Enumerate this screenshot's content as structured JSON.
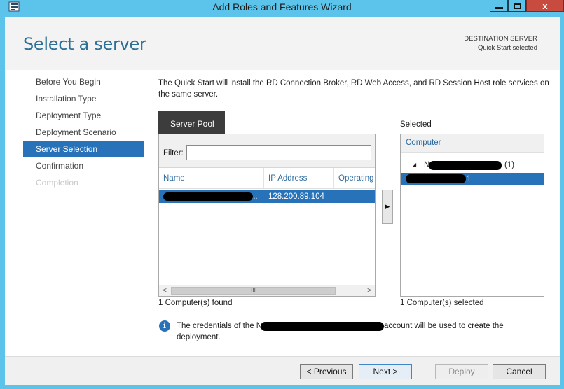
{
  "window": {
    "title": "Add Roles and Features Wizard",
    "minimize_icon": "minimize-icon",
    "maximize_icon": "maximize-icon",
    "close_label": "x"
  },
  "header": {
    "page_title": "Select a server",
    "destination_label": "DESTINATION SERVER",
    "destination_value": "Quick Start selected"
  },
  "nav": {
    "items": [
      {
        "label": "Before You Begin",
        "state": "normal"
      },
      {
        "label": "Installation Type",
        "state": "normal"
      },
      {
        "label": "Deployment Type",
        "state": "normal"
      },
      {
        "label": "Deployment Scenario",
        "state": "normal"
      },
      {
        "label": "Server Selection",
        "state": "active"
      },
      {
        "label": "Confirmation",
        "state": "normal"
      },
      {
        "label": "Completion",
        "state": "disabled"
      }
    ]
  },
  "content": {
    "description": "The Quick Start will install the RD Connection Broker, RD Web Access, and RD Session Host role services on the same server.",
    "pool_tab_label": "Server Pool",
    "filter_label": "Filter:",
    "filter_value": "",
    "columns": [
      "Name",
      "IP Address",
      "Operating"
    ],
    "rows": [
      {
        "name_suffix": "...",
        "ip": "128.200.89.104"
      }
    ],
    "scroll_thumb_glyph": "III",
    "scroll_left": "<",
    "scroll_right": ">",
    "found_text": "1 Computer(s) found",
    "add_glyph": "▶",
    "selected_label": "Selected",
    "selected_column": "Computer",
    "selected_group_prefix": "N",
    "selected_group_suffix": "(1)",
    "selected_item_suffix": "1",
    "selected_found_text": "1 Computer(s) selected",
    "info_icon_glyph": "i",
    "info_text_prefix": "The credentials of the N",
    "info_text_suffix": "account will be used to create the",
    "info_text_line2": "deployment."
  },
  "footer": {
    "previous": "< Previous",
    "next": "Next >",
    "deploy": "Deploy",
    "cancel": "Cancel"
  },
  "colors": {
    "title_bar": "#5cc3ea",
    "accent": "#2772b9",
    "page_title": "#2d6f96",
    "close_button": "#c74b3f"
  }
}
